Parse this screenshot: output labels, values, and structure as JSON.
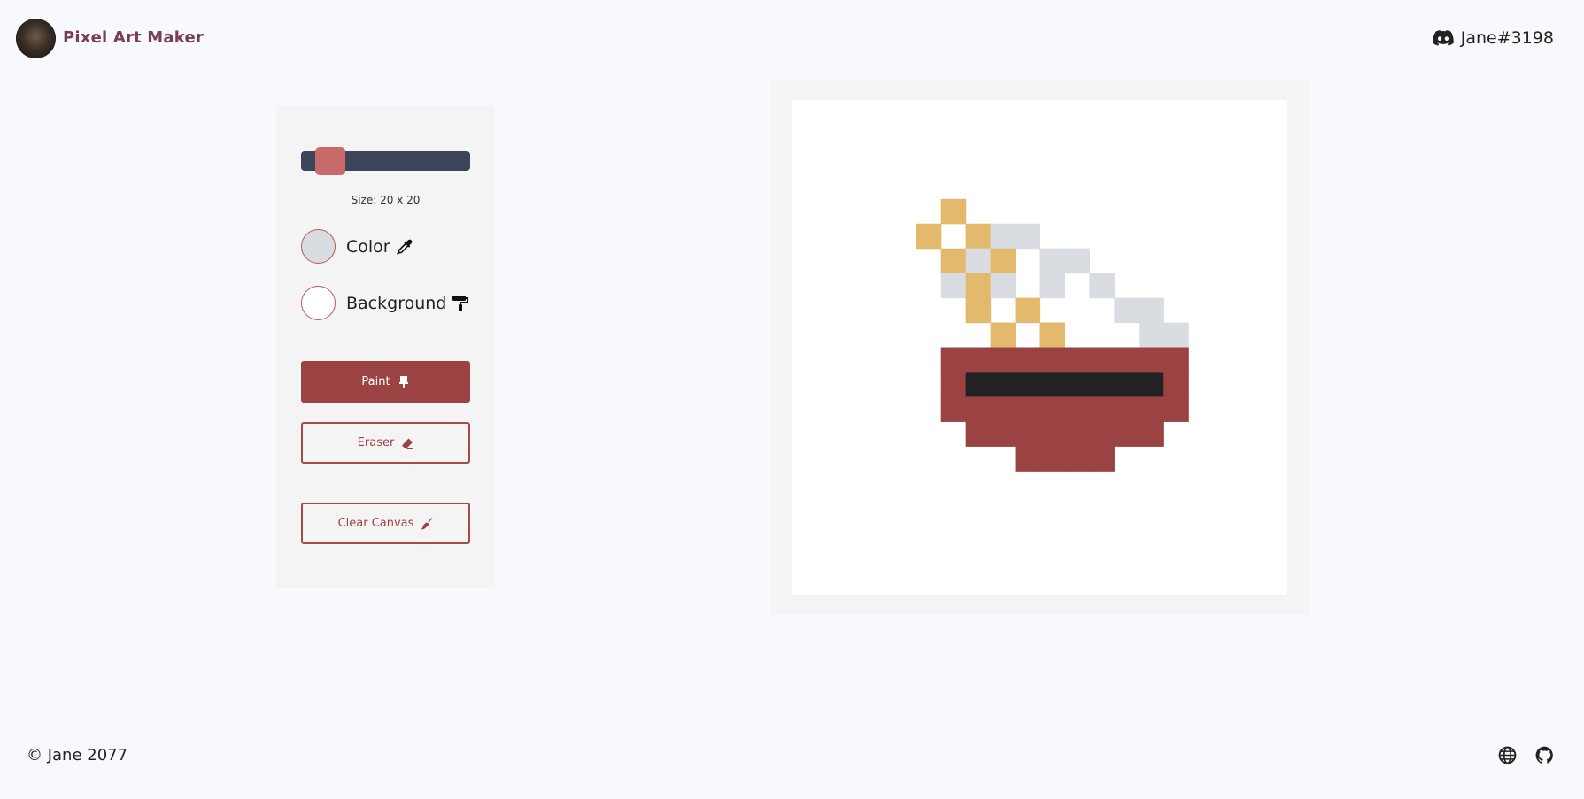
{
  "header": {
    "brand": "Pixel Art Maker",
    "user": "Jane#3198",
    "user_icon": "discord-icon"
  },
  "controls": {
    "size_label": "Size: 20 x 20",
    "grid_size": 20,
    "slider_fraction": 0.1,
    "color_label": "Color",
    "color_value": "#d9dde2",
    "color_icon": "eyedropper-icon",
    "background_label": "Background",
    "background_value": "#ffffff",
    "background_icon": "paint-roller-icon",
    "paint_label": "Paint",
    "paint_icon": "brush-icon",
    "eraser_label": "Eraser",
    "eraser_icon": "eraser-icon",
    "clear_label": "Clear Canvas",
    "clear_icon": "broom-icon"
  },
  "colors": {
    "accent": "#9b4242",
    "slider_track": "#3b4458",
    "slider_thumb": "#c96a6a",
    "gold": "#e3b96e",
    "steam": "#d9dde2",
    "bowl": "#9b4242",
    "dark": "#222222"
  },
  "artwork": {
    "rows": [
      "....................",
      "....................",
      "....................",
      "....................",
      "......Y.............",
      ".....Y.YSS..........",
      "......YSY.SS........",
      "......SYS.S.S.......",
      ".......Y.Y...SS.....",
      "........Y.Y...SS....",
      "......RRRRRRRRRR....",
      "......RKKKKKKKKR....",
      "......RRRRRRRRRR....",
      ".......RRRRRRRR.....",
      ".........RRRR.......",
      "....................",
      "....................",
      "....................",
      "....................",
      "...................."
    ],
    "palette": {
      "Y": "#e3b96e",
      "S": "#d9dde2",
      "R": "#9b4242",
      "K": "#222222"
    }
  },
  "footer": {
    "copyright": "© Jane 2077",
    "icons": [
      "globe-icon",
      "github-icon"
    ]
  }
}
